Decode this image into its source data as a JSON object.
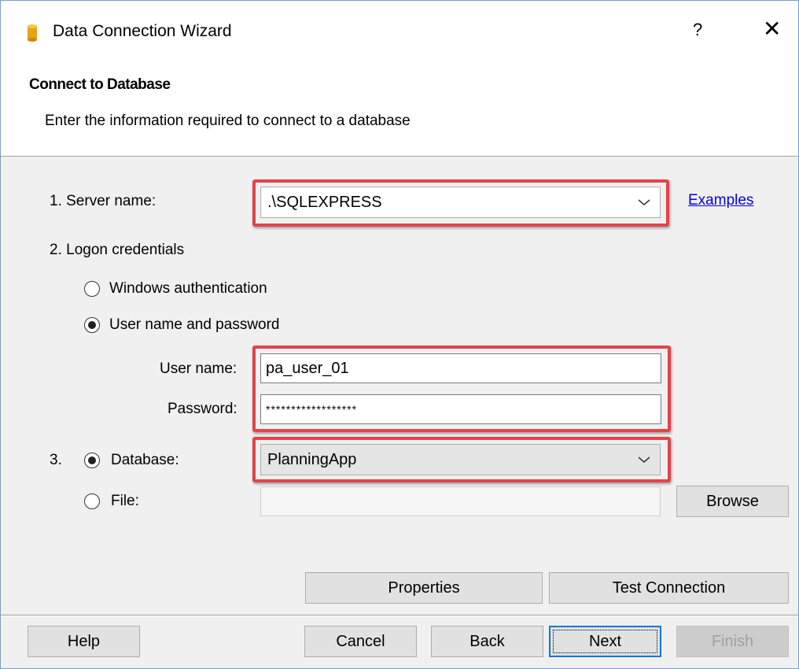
{
  "window": {
    "title": "Data Connection Wizard",
    "help_glyph": "?",
    "close_glyph": "✕"
  },
  "header": {
    "heading": "Connect to Database",
    "subheading": "Enter the information required to connect to a database"
  },
  "server": {
    "label": "1. Server name:",
    "value": ".\\SQLEXPRESS",
    "examples_link": "Examples"
  },
  "credentials": {
    "label": "2. Logon credentials",
    "windows_auth_label": "Windows authentication",
    "user_pass_label": "User name and password",
    "selected": "user_pass",
    "username_label": "User name:",
    "username_value": "pa_user_01",
    "password_label": "Password:",
    "password_value": "******************"
  },
  "database": {
    "number": "3.",
    "database_label": "Database:",
    "database_value": "PlanningApp",
    "file_label": "File:",
    "file_value": "",
    "browse_label": "Browse",
    "selected": "database"
  },
  "actions": {
    "properties_label": "Properties",
    "test_connection_label": "Test Connection"
  },
  "footer": {
    "help_label": "Help",
    "cancel_label": "Cancel",
    "back_label": "Back",
    "next_label": "Next",
    "finish_label": "Finish"
  },
  "colors": {
    "highlight": "#e4434b",
    "db_icon": "#e8a317",
    "link": "#0000ee",
    "default_button_border": "#0078d7"
  },
  "icons": {
    "title_icon": "database-icon",
    "dropdown": "chevron-down-icon",
    "close": "close-icon"
  }
}
